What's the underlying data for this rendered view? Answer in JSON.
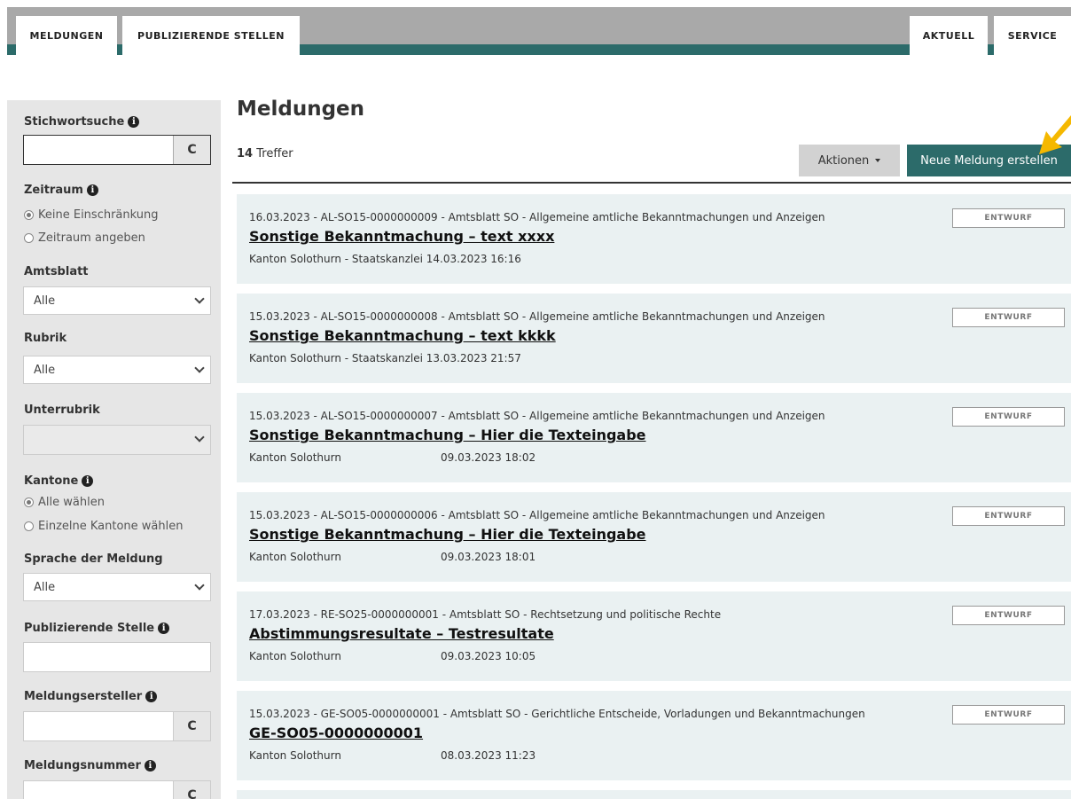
{
  "nav": {
    "tabs_left": [
      "MELDUNGEN",
      "PUBLIZIERENDE STELLEN"
    ],
    "tabs_right": [
      "AKTUELL",
      "SERVICE"
    ]
  },
  "sidebar": {
    "keyword_label": "Stichwortsuche",
    "period_label": "Zeitraum",
    "period_opt1": "Keine Einschränkung",
    "period_opt2": "Zeitraum angeben",
    "amtsblatt_label": "Amtsblatt",
    "amtsblatt_value": "Alle",
    "rubrik_label": "Rubrik",
    "rubrik_value": "Alle",
    "unterrubrik_label": "Unterrubrik",
    "unterrubrik_value": "",
    "kantone_label": "Kantone",
    "kantone_opt1": "Alle wählen",
    "kantone_opt2": "Einzelne Kantone wählen",
    "sprache_label": "Sprache der Meldung",
    "sprache_value": "Alle",
    "pubstelle_label": "Publizierende Stelle",
    "ersteller_label": "Meldungsersteller",
    "nummer_label": "Meldungsnummer",
    "refresh_symbol": "C"
  },
  "main": {
    "title": "Meldungen",
    "count": "14",
    "count_label": "Treffer",
    "actions_label": "Aktionen",
    "new_label": "Neue Meldung erstellen"
  },
  "items": [
    {
      "meta": "16.03.2023 - AL-SO15-0000000009 - Amtsblatt SO - Allgemeine amtliche Bekanntmachungen und Anzeigen",
      "title": "Sonstige Bekanntmachung – text xxxx",
      "sub": "Kanton Solothurn - Staatskanzlei 14.03.2023 16:16",
      "date": "",
      "badge": "ENTWURF"
    },
    {
      "meta": "15.03.2023 - AL-SO15-0000000008 - Amtsblatt SO - Allgemeine amtliche Bekanntmachungen und Anzeigen",
      "title": "Sonstige Bekanntmachung – text kkkk",
      "sub": "Kanton Solothurn - Staatskanzlei 13.03.2023 21:57",
      "date": "",
      "badge": "ENTWURF"
    },
    {
      "meta": "15.03.2023 - AL-SO15-0000000007 - Amtsblatt SO - Allgemeine amtliche Bekanntmachungen und Anzeigen",
      "title": "Sonstige Bekanntmachung – Hier die Texteingabe",
      "sub": "Kanton Solothurn",
      "date": "09.03.2023 18:02",
      "badge": "ENTWURF"
    },
    {
      "meta": "15.03.2023 - AL-SO15-0000000006 - Amtsblatt SO - Allgemeine amtliche Bekanntmachungen und Anzeigen",
      "title": "Sonstige Bekanntmachung – Hier die Texteingabe",
      "sub": "Kanton Solothurn",
      "date": "09.03.2023 18:01",
      "badge": "ENTWURF"
    },
    {
      "meta": "17.03.2023 - RE-SO25-0000000001 - Amtsblatt SO - Rechtsetzung und politische Rechte",
      "title": "Abstimmungsresultate – Testresultate",
      "sub": "Kanton Solothurn",
      "date": "09.03.2023 10:05",
      "badge": "ENTWURF"
    },
    {
      "meta": "15.03.2023 - GE-SO05-0000000001 - Amtsblatt SO - Gerichtliche Entscheide, Vorladungen und Bekanntmachungen",
      "title": "GE-SO05-0000000001",
      "sub": "Kanton Solothurn",
      "date": "08.03.2023 11:23",
      "badge": "ENTWURF"
    }
  ],
  "colors": {
    "accent": "#2c6b6a",
    "nav_gray": "#a9a9a9",
    "sidebar_bg": "#e6e6e6",
    "card_bg": "#eaf1f2",
    "highlight_arrow": "#f5b800"
  }
}
